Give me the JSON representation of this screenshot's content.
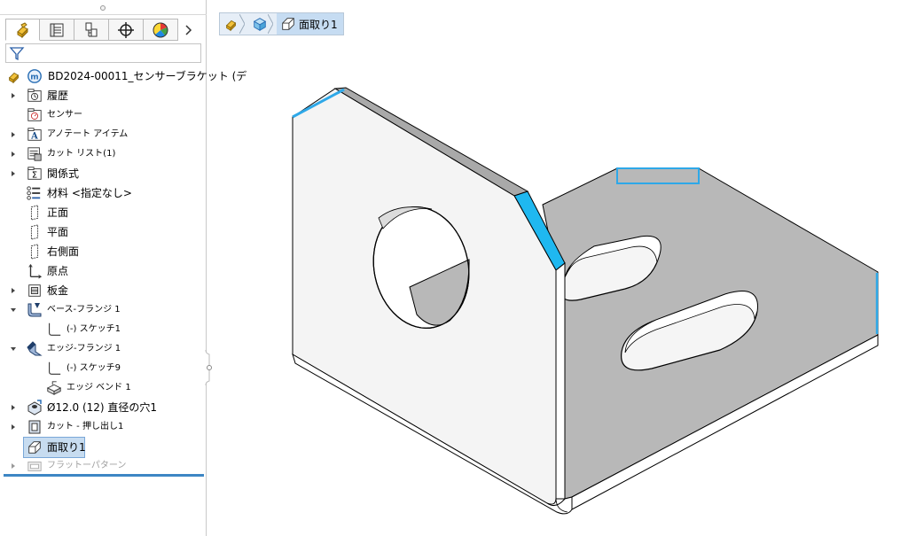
{
  "feature_tree": {
    "tabs": [
      "feature-manager-icon",
      "property-manager-icon",
      "configuration-manager-icon",
      "dimxpert-icon",
      "display-manager-icon"
    ],
    "root_label": "BD2024-00011_センサーブラケット (デ",
    "items": [
      {
        "label": "履歴",
        "icon": "history-folder-icon",
        "expandable": true
      },
      {
        "label": "センサー",
        "icon": "sensor-folder-icon",
        "expandable": false
      },
      {
        "label": "アノテート アイテム",
        "icon": "annotations-folder-icon",
        "expandable": true
      },
      {
        "label": "カット リスト(1)",
        "icon": "cut-list-icon",
        "expandable": true
      },
      {
        "label": "関係式",
        "icon": "equations-folder-icon",
        "expandable": true
      },
      {
        "label": "材料 <指定なし>",
        "icon": "material-icon",
        "expandable": false
      },
      {
        "label": "正面",
        "icon": "plane-icon",
        "expandable": false
      },
      {
        "label": "平面",
        "icon": "plane-icon",
        "expandable": false
      },
      {
        "label": "右側面",
        "icon": "plane-icon",
        "expandable": false
      },
      {
        "label": "原点",
        "icon": "origin-icon",
        "expandable": false
      },
      {
        "label": "板金",
        "icon": "sheet-metal-icon",
        "expandable": true
      },
      {
        "label": "ベース-フランジ 1",
        "icon": "base-flange-icon",
        "expandable": true,
        "expanded": true
      },
      {
        "label": "(-) スケッチ1",
        "icon": "sketch-icon",
        "expandable": false
      },
      {
        "label": "エッジ-フランジ 1",
        "icon": "edge-flange-icon",
        "expandable": true,
        "expanded": true
      },
      {
        "label": "(-) スケッチ9",
        "icon": "sketch-icon",
        "expandable": false
      },
      {
        "label": "エッジ ベンド 1",
        "icon": "bend-icon",
        "expandable": false
      },
      {
        "label": "Ø12.0 (12) 直径の穴1",
        "icon": "hole-wizard-icon",
        "expandable": true
      },
      {
        "label": "カット - 押し出し1",
        "icon": "cut-extrude-icon",
        "expandable": true
      },
      {
        "label": "面取り1",
        "icon": "chamfer-icon",
        "expandable": false,
        "selected": true
      },
      {
        "label": "フラットーパターン",
        "icon": "flat-pattern-icon",
        "expandable": true,
        "suppressed": true
      }
    ]
  },
  "breadcrumb": {
    "current": "面取り1"
  },
  "colors": {
    "selection_highlight": "#c7dcf0",
    "edge_highlight": "#1fb8f0",
    "accent_line": "#3d86c4"
  }
}
